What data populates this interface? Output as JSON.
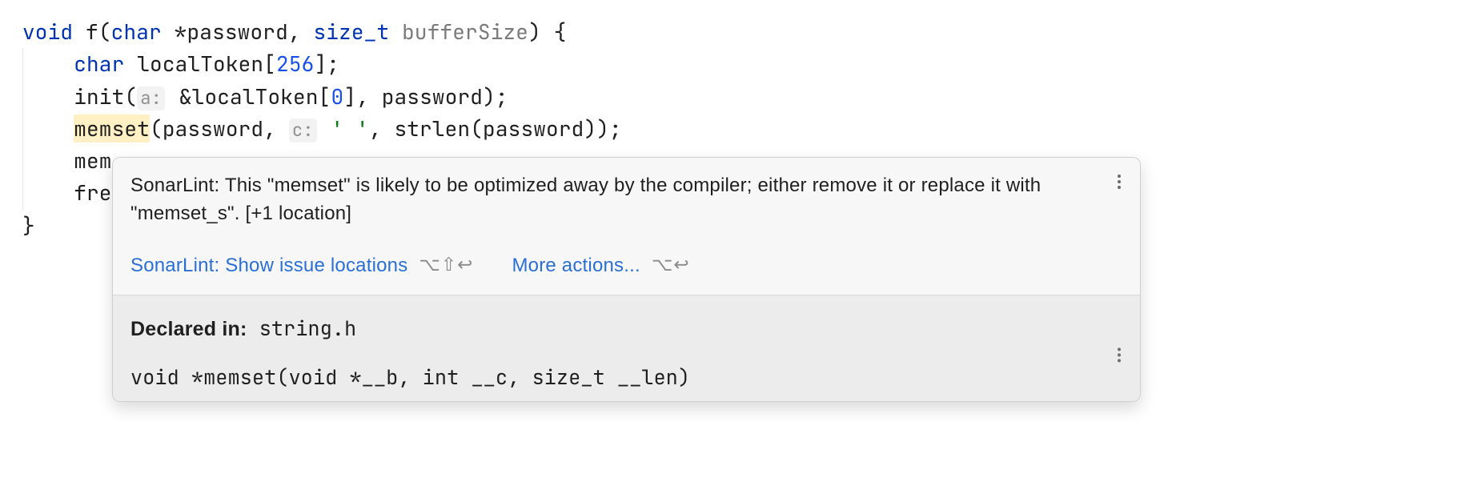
{
  "code": {
    "line1": {
      "kw_void": "void",
      "fn_name": "f",
      "kw_char": "char",
      "star": "*",
      "param1": "password",
      "comma": ", ",
      "type_size_t": "size_t",
      "param2": "bufferSize",
      "tail": ") {"
    },
    "line2": {
      "kw_char": "char",
      "id": "localToken",
      "lbr": "[",
      "num": "256",
      "rbr_tail": "];"
    },
    "line3": {
      "fn": "init",
      "open": "(",
      "hint_a": "a:",
      "amp_id": "&localToken",
      "lbr": "[",
      "num": "0",
      "rbr": "]",
      "rest": ", password);"
    },
    "line4": {
      "fn": "memset",
      "open": "(password, ",
      "hint_c": "c:",
      "str": "' '",
      "rest": ", strlen(password));"
    },
    "line5_prefix": "mem",
    "line6_prefix": "fre",
    "line7_brace": "}"
  },
  "tooltip": {
    "message": "SonarLint: This \"memset\" is likely to be optimized away by the compiler; either remove it or replace it with \"memset_s\". [+1 location]",
    "action1_label": "SonarLint: Show issue locations",
    "action1_shortcut": "⌥⇧↩",
    "action2_label": "More actions...",
    "action2_shortcut": "⌥↩",
    "declared_label": "Declared in:",
    "declared_value": "string.h",
    "signature": "void *memset(void *__b, int __c, size_t __len)"
  }
}
